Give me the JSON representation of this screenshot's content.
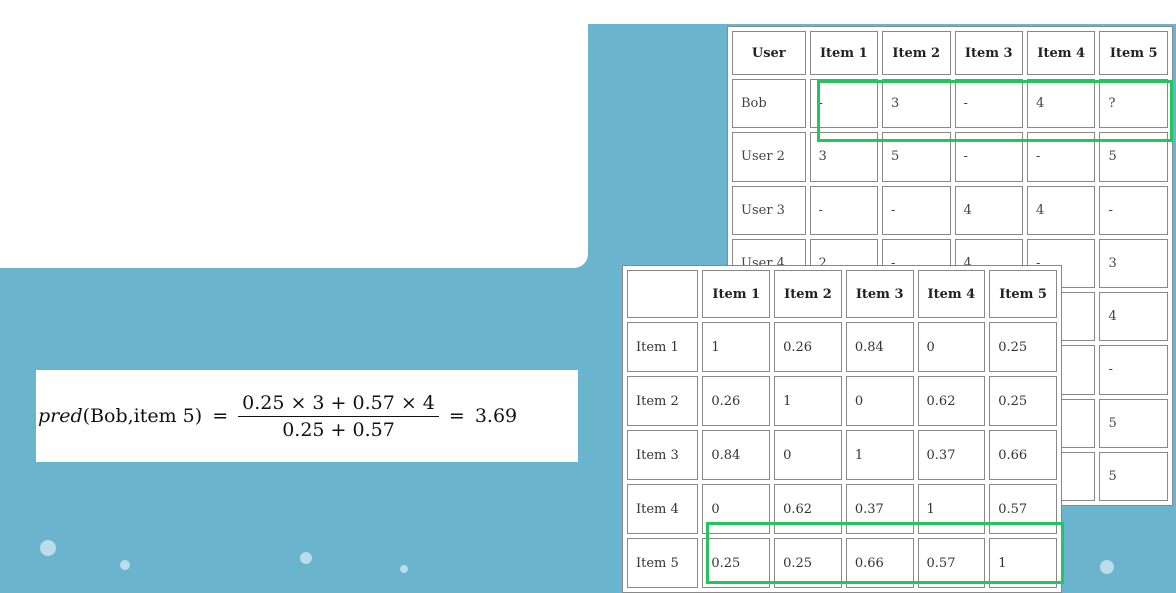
{
  "formula": {
    "pred": "pred",
    "args": "(Bob,item 5)",
    "equals": "=",
    "numerator": "0.25 × 3 + 0.57 × 4",
    "denominator": "0.25 + 0.57",
    "equals2": "=",
    "result": "3.69"
  },
  "ratings": {
    "headers": [
      "User",
      "Item 1",
      "Item 2",
      "Item 3",
      "Item 4",
      "Item 5"
    ],
    "rows": [
      [
        "Bob",
        "-",
        "3",
        "-",
        "4",
        "?"
      ],
      [
        "User 2",
        "3",
        "5",
        "-",
        "-",
        "5"
      ],
      [
        "User 3",
        "-",
        "-",
        "4",
        "4",
        "-"
      ],
      [
        "User 4",
        "2",
        "-",
        "4",
        "-",
        "3"
      ],
      [
        "",
        "",
        "",
        "",
        "",
        "4"
      ],
      [
        "",
        "",
        "",
        "",
        "",
        "-"
      ],
      [
        "",
        "",
        "",
        "",
        "",
        "5"
      ],
      [
        "",
        "",
        "",
        "",
        "",
        "5"
      ]
    ]
  },
  "similarity": {
    "headers": [
      "",
      "Item 1",
      "Item 2",
      "Item 3",
      "Item 4",
      "Item 5"
    ],
    "rows": [
      [
        "Item 1",
        "1",
        "0.26",
        "0.84",
        "0",
        "0.25"
      ],
      [
        "Item 2",
        "0.26",
        "1",
        "0",
        "0.62",
        "0.25"
      ],
      [
        "Item 3",
        "0.84",
        "0",
        "1",
        "0.37",
        "0.66"
      ],
      [
        "Item 4",
        "0",
        "0.62",
        "0.37",
        "1",
        "0.57"
      ],
      [
        "Item 5",
        "0.25",
        "0.25",
        "0.66",
        "0.57",
        "1"
      ]
    ]
  },
  "colors": {
    "background": "#6ab4cd",
    "highlight": "#22c55e"
  }
}
